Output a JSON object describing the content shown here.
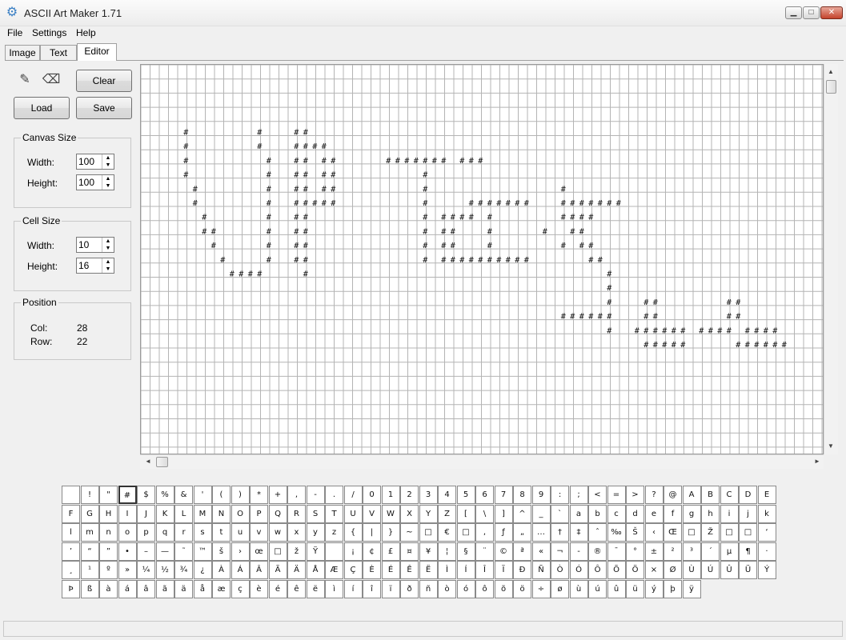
{
  "window": {
    "title": "ASCII Art Maker 1.71",
    "icon": "gear-icon",
    "min_glyph": "▁",
    "max_glyph": "□",
    "close_glyph": "✕"
  },
  "menu": {
    "file": "File",
    "settings": "Settings",
    "help": "Help"
  },
  "tabs": {
    "image": "Image",
    "text": "Text",
    "editor": "Editor",
    "active": "Editor"
  },
  "tools": {
    "pencil_glyph": "✎",
    "eraser_glyph": "⌫",
    "clear": "Clear",
    "load": "Load",
    "save": "Save"
  },
  "canvas_size": {
    "title": "Canvas Size",
    "width_label": "Width:",
    "width": "100",
    "height_label": "Height:",
    "height": "100"
  },
  "cell_size": {
    "title": "Cell Size",
    "width_label": "Width:",
    "width": "10",
    "height_label": "Height:",
    "height": "16"
  },
  "position": {
    "title": "Position",
    "col_label": "Col:",
    "col": "28",
    "row_label": "Row:",
    "row": "22"
  },
  "scroll": {
    "up": "▲",
    "down": "▼",
    "left": "◄",
    "right": "►"
  },
  "canvas": {
    "hash_char": "#",
    "rows": [
      "",
      "",
      "",
      "",
      "    #       #   ##",
      "    #       #   ####",
      "    #        #  ## ##     ####### ###",
      "    #        #  ## ##         #",
      "     #       #  ## ##         #              #",
      "     #       #  #####         #    #######   #######",
      "      #      #  ##            # #### #       ####",
      "      ##     #  ##            # ##   #     #  ##",
      "       #     #  ##            # ##   #       # ##",
      "        #    #  ##            # ##########      ##",
      "         ####    #                                #",
      "                                                  #",
      "                                                  #   ##       ##",
      "                                             ######   ##       ##",
      "                                                  #  ###### #### ####",
      "                                                      #####     ######"
    ]
  },
  "charset": {
    "selected": "#",
    "row1": [
      " ",
      "!",
      "\"",
      "#",
      "$",
      "%",
      "&",
      "'",
      "(",
      ")",
      "*",
      "+",
      ",",
      "-",
      ".",
      "/",
      "0",
      "1",
      "2",
      "3",
      "4",
      "5",
      "6",
      "7",
      "8",
      "9",
      ":",
      ";",
      "<",
      "=",
      ">",
      "?",
      "@",
      "A",
      "B",
      "C",
      "D",
      "E"
    ],
    "row2": [
      "F",
      "G",
      "H",
      "I",
      "J",
      "K",
      "L",
      "M",
      "N",
      "O",
      "P",
      "Q",
      "R",
      "S",
      "T",
      "U",
      "V",
      "W",
      "X",
      "Y",
      "Z",
      "[",
      "\\",
      "]",
      "^",
      "_",
      "`",
      "a",
      "b",
      "c",
      "d",
      "e",
      "f",
      "g",
      "h",
      "i",
      "j",
      "k"
    ],
    "row3": [
      "l",
      "m",
      "n",
      "o",
      "p",
      "q",
      "r",
      "s",
      "t",
      "u",
      "v",
      "w",
      "x",
      "y",
      "z",
      "{",
      "|",
      "}",
      "~",
      "□",
      "€",
      "□",
      ",",
      "ƒ",
      "„",
      "…",
      "†",
      "‡",
      "ˆ",
      "‰",
      "Š",
      "‹",
      "Œ",
      "□",
      "Ž",
      "□",
      "□",
      "‘"
    ],
    "row4": [
      "’",
      "“",
      "”",
      "•",
      "–",
      "—",
      "˜",
      "™",
      "š",
      "›",
      "œ",
      "□",
      "ž",
      "Ÿ",
      " ",
      "¡",
      "¢",
      "£",
      "¤",
      "¥",
      "¦",
      "§",
      "¨",
      "©",
      "ª",
      "«",
      "¬",
      "-",
      "®",
      "¯",
      "°",
      "±",
      "²",
      "³",
      "´",
      "µ",
      "¶",
      "·"
    ],
    "row5": [
      "¸",
      "¹",
      "º",
      "»",
      "¼",
      "½",
      "¾",
      "¿",
      "À",
      "Á",
      "Â",
      "Ã",
      "Ä",
      "Å",
      "Æ",
      "Ç",
      "È",
      "É",
      "Ê",
      "Ë",
      "Ì",
      "Í",
      "Î",
      "Ï",
      "Ð",
      "Ñ",
      "Ò",
      "Ó",
      "Ô",
      "Õ",
      "Ö",
      "×",
      "Ø",
      "Ù",
      "Ú",
      "Û",
      "Ü",
      "Ý"
    ],
    "row6": [
      "Þ",
      "ß",
      "à",
      "á",
      "â",
      "ã",
      "ä",
      "å",
      "æ",
      "ç",
      "è",
      "é",
      "ê",
      "ë",
      "ì",
      "í",
      "î",
      "ï",
      "ð",
      "ñ",
      "ò",
      "ó",
      "ô",
      "õ",
      "ö",
      "÷",
      "ø",
      "ù",
      "ú",
      "û",
      "ü",
      "ý",
      "þ",
      "ÿ"
    ]
  },
  "status": {
    "text": ""
  }
}
